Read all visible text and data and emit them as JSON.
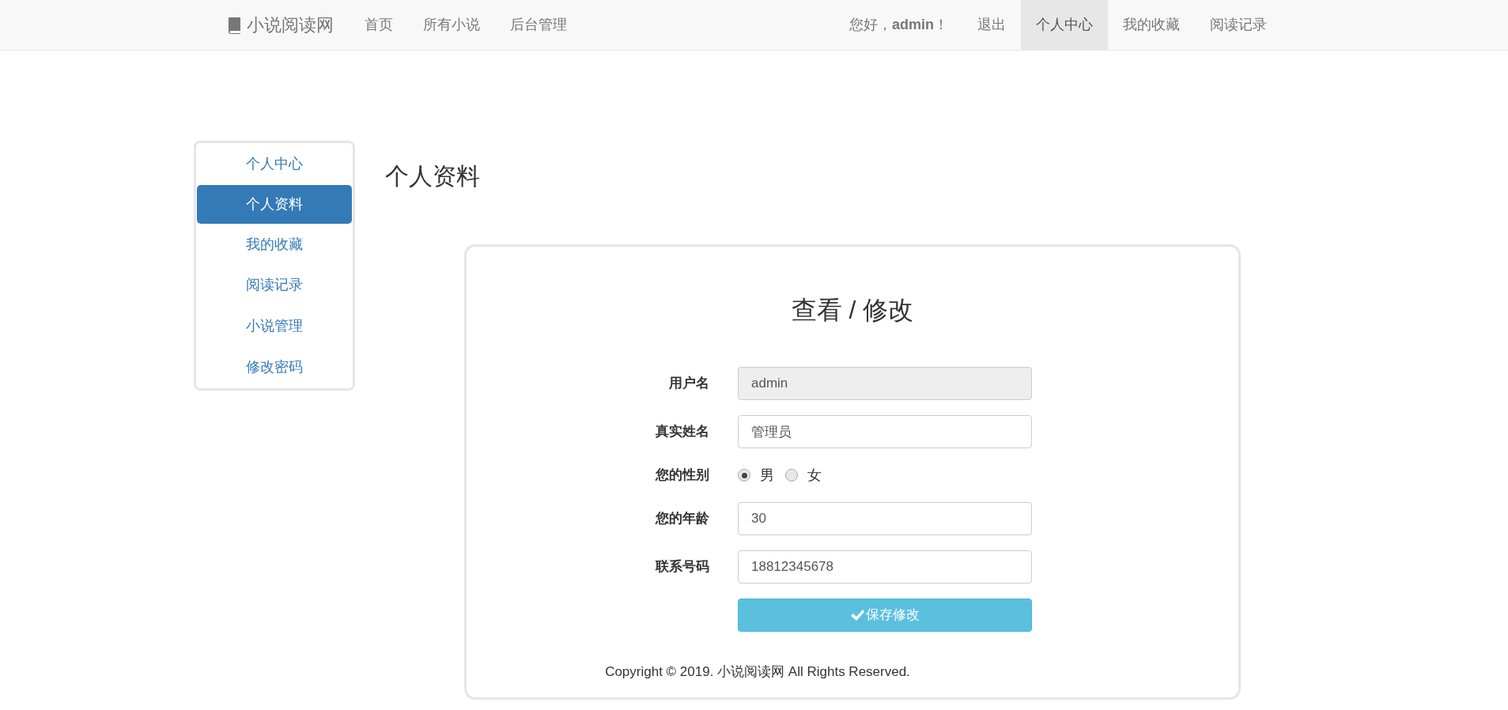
{
  "navbar": {
    "brand": "小说阅读网",
    "left_links": [
      {
        "label": "首页",
        "selected": false
      },
      {
        "label": "所有小说",
        "selected": false
      },
      {
        "label": "后台管理",
        "selected": false
      }
    ],
    "greeting": "您好，**admin**！",
    "right_links": [
      {
        "label": "退出",
        "selected": false
      },
      {
        "label": "个人中心",
        "selected": true
      },
      {
        "label": "我的收藏",
        "selected": false
      },
      {
        "label": "阅读记录",
        "selected": false
      }
    ]
  },
  "sidebar": {
    "items": [
      {
        "label": "个人中心",
        "selected": false
      },
      {
        "label": "个人资料",
        "selected": true
      },
      {
        "label": "我的收藏",
        "selected": false
      },
      {
        "label": "阅读记录",
        "selected": false
      },
      {
        "label": "小说管理",
        "selected": false
      },
      {
        "label": "修改密码",
        "selected": false
      }
    ]
  },
  "page_title": "个人资料",
  "form": {
    "title": "查看 / 修改",
    "fields": [
      {
        "kind": "text",
        "label": "用户名",
        "value": "admin",
        "disabled": true
      },
      {
        "kind": "text",
        "label": "真实姓名",
        "value": "管理员",
        "disabled": false
      },
      {
        "kind": "radio",
        "label": "您的性别",
        "options": [
          {
            "label": "男",
            "selected": true
          },
          {
            "label": "女",
            "selected": false
          }
        ]
      },
      {
        "kind": "text",
        "label": "您的年龄",
        "value": "30",
        "disabled": false
      },
      {
        "kind": "text",
        "label": "联系号码",
        "value": "18812345678",
        "disabled": false
      }
    ],
    "submit": "保存修改"
  },
  "footer": "Copyright © 2019. 小说阅读网 All Rights Reserved."
}
